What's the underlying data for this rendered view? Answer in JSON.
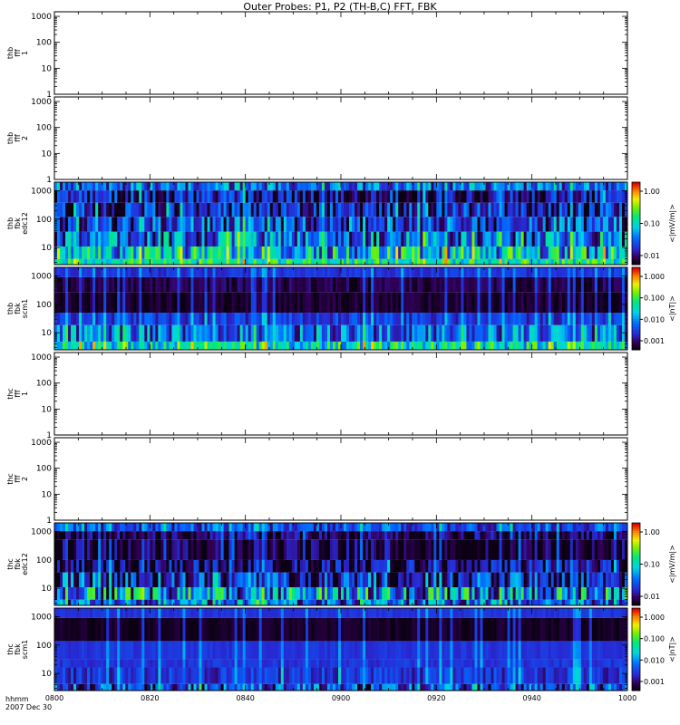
{
  "title": "Outer Probes: P1, P2 (TH-B,C) FFT, FBK",
  "time_axis": {
    "ticks": [
      "0800",
      "0820",
      "0840",
      "0900",
      "0920",
      "0940",
      "1000"
    ],
    "row_label": "hhmm",
    "date_label": "2007 Dec 30"
  },
  "chart_data": [
    {
      "type": "heatmap",
      "panel": "thb-fff1",
      "ylabel": [
        "thb",
        "fff",
        "1"
      ],
      "y_ticks": [
        "1",
        "10",
        "100",
        "1000"
      ],
      "ylim": [
        1,
        1500
      ],
      "log_scale": true,
      "has_data": false,
      "colorbar": null
    },
    {
      "type": "heatmap",
      "panel": "thb-fff2",
      "ylabel": [
        "thb",
        "fff",
        "2"
      ],
      "y_ticks": [
        "1",
        "10",
        "100",
        "1000"
      ],
      "ylim": [
        1,
        1500
      ],
      "log_scale": true,
      "has_data": false,
      "colorbar": null
    },
    {
      "type": "heatmap",
      "panel": "thb-fbk-edc12",
      "ylabel": [
        "thb",
        "fbk",
        "edc12"
      ],
      "y_ticks": [
        "10",
        "100",
        "1000"
      ],
      "ylim": [
        2.5,
        2000
      ],
      "log_scale": true,
      "has_data": true,
      "seed": 11,
      "colorbar": {
        "label": "<|mV/m|>",
        "ticks": [
          "1.00",
          "0.10",
          "0.01"
        ]
      },
      "bands": [
        {
          "lo": 0.0,
          "hi": 0.07,
          "level": 0.55,
          "spread": 0.18
        },
        {
          "lo": 0.07,
          "hi": 0.22,
          "level": 0.42,
          "spread": 0.3
        },
        {
          "lo": 0.22,
          "hi": 0.4,
          "level": 0.3,
          "spread": 0.28
        },
        {
          "lo": 0.4,
          "hi": 0.58,
          "level": 0.22,
          "spread": 0.25
        },
        {
          "lo": 0.58,
          "hi": 0.75,
          "level": 0.15,
          "spread": 0.22
        },
        {
          "lo": 0.75,
          "hi": 0.9,
          "level": 0.12,
          "spread": 0.22
        },
        {
          "lo": 0.9,
          "hi": 1.0,
          "level": 0.28,
          "spread": 0.2
        }
      ]
    },
    {
      "type": "heatmap",
      "panel": "thb-fbk-scm1",
      "ylabel": [
        "thb",
        "fbk",
        "scm1"
      ],
      "y_ticks": [
        "10",
        "100",
        "1000"
      ],
      "ylim": [
        2.5,
        2000
      ],
      "log_scale": true,
      "has_data": true,
      "seed": 23,
      "colorbar": {
        "label": "<|nT|>",
        "ticks": [
          "1.000",
          "0.100",
          "0.010",
          "0.001"
        ]
      },
      "bands": [
        {
          "lo": 0.0,
          "hi": 0.1,
          "level": 0.5,
          "spread": 0.22
        },
        {
          "lo": 0.1,
          "hi": 0.3,
          "level": 0.3,
          "spread": 0.22
        },
        {
          "lo": 0.3,
          "hi": 0.45,
          "level": 0.22,
          "spread": 0.1
        },
        {
          "lo": 0.45,
          "hi": 0.7,
          "level": 0.03,
          "spread": 0.05
        },
        {
          "lo": 0.7,
          "hi": 0.88,
          "level": 0.06,
          "spread": 0.06
        },
        {
          "lo": 0.88,
          "hi": 1.0,
          "level": 0.2,
          "spread": 0.05
        }
      ]
    },
    {
      "type": "heatmap",
      "panel": "thc-fff1",
      "ylabel": [
        "thc",
        "fff",
        "1"
      ],
      "y_ticks": [
        "1",
        "10",
        "100",
        "1000"
      ],
      "ylim": [
        1,
        1500
      ],
      "log_scale": true,
      "has_data": false,
      "colorbar": null
    },
    {
      "type": "heatmap",
      "panel": "thc-fff2",
      "ylabel": [
        "thc",
        "fff",
        "2"
      ],
      "y_ticks": [
        "1",
        "10",
        "100",
        "1000"
      ],
      "ylim": [
        1,
        1500
      ],
      "log_scale": true,
      "has_data": false,
      "colorbar": null
    },
    {
      "type": "heatmap",
      "panel": "thc-fbk-edc12",
      "ylabel": [
        "thc",
        "fbk",
        "edc12"
      ],
      "y_ticks": [
        "10",
        "100",
        "1000"
      ],
      "ylim": [
        2.5,
        2000
      ],
      "log_scale": true,
      "has_data": true,
      "seed": 37,
      "colorbar": {
        "label": "<|mV/m|>",
        "ticks": [
          "1.00",
          "0.10",
          "0.01"
        ]
      },
      "bands": [
        {
          "lo": 0.0,
          "hi": 0.07,
          "level": 0.3,
          "spread": 0.25
        },
        {
          "lo": 0.07,
          "hi": 0.22,
          "level": 0.35,
          "spread": 0.35
        },
        {
          "lo": 0.22,
          "hi": 0.4,
          "level": 0.15,
          "spread": 0.3
        },
        {
          "lo": 0.4,
          "hi": 0.55,
          "level": 0.08,
          "spread": 0.2
        },
        {
          "lo": 0.55,
          "hi": 0.8,
          "level": 0.03,
          "spread": 0.15
        },
        {
          "lo": 0.8,
          "hi": 0.9,
          "level": 0.05,
          "spread": 0.15
        },
        {
          "lo": 0.9,
          "hi": 1.0,
          "level": 0.25,
          "spread": 0.15
        }
      ]
    },
    {
      "type": "heatmap",
      "panel": "thc-fbk-scm1",
      "ylabel": [
        "thc",
        "fbk",
        "scm1"
      ],
      "y_ticks": [
        "10",
        "100",
        "1000"
      ],
      "ylim": [
        2.5,
        2000
      ],
      "log_scale": true,
      "has_data": true,
      "seed": 51,
      "colorbar": {
        "label": "<|nT|>",
        "ticks": [
          "1.000",
          "0.100",
          "0.010",
          "0.001"
        ]
      },
      "bands": [
        {
          "lo": 0.0,
          "hi": 0.08,
          "level": 0.22,
          "spread": 0.25
        },
        {
          "lo": 0.08,
          "hi": 0.28,
          "level": 0.2,
          "spread": 0.1
        },
        {
          "lo": 0.28,
          "hi": 0.38,
          "level": 0.2,
          "spread": 0.04
        },
        {
          "lo": 0.38,
          "hi": 0.6,
          "level": 0.2,
          "spread": 0.03
        },
        {
          "lo": 0.6,
          "hi": 0.88,
          "level": 0.02,
          "spread": 0.03
        },
        {
          "lo": 0.88,
          "hi": 1.0,
          "level": 0.2,
          "spread": 0.03
        }
      ]
    }
  ]
}
